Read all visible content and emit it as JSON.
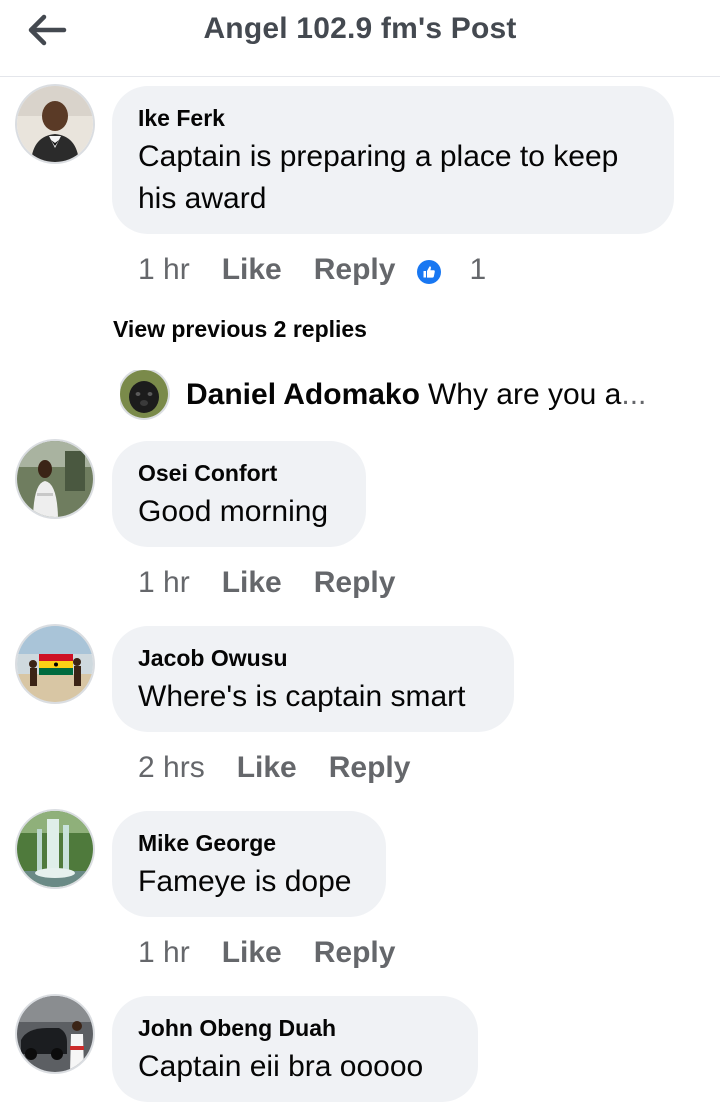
{
  "header": {
    "title": "Angel 102.9 fm's Post"
  },
  "comments": [
    {
      "author": "Ike Ferk",
      "text": "Captain is preparing a place to keep his award",
      "time": "1 hr",
      "like": "Like",
      "reply": "Reply",
      "reaction_count": "1"
    },
    {
      "author": "Osei Confort",
      "text": "Good morning",
      "time": "1 hr",
      "like": "Like",
      "reply": "Reply"
    },
    {
      "author": "Jacob Owusu",
      "text": "Where's is captain smart",
      "time": "2 hrs",
      "like": "Like",
      "reply": "Reply"
    },
    {
      "author": "Mike George",
      "text": "Fameye is dope",
      "time": "1 hr",
      "like": "Like",
      "reply": "Reply"
    },
    {
      "author": "John Obeng Duah",
      "text": "Captain eii bra ooooo"
    }
  ],
  "thread": {
    "view_previous": "View previous 2 replies",
    "preview_author": "Daniel Adomako",
    "preview_text": "Why are you a",
    "preview_ellipsis": "..."
  },
  "icons": {
    "back": "back-arrow-icon",
    "reaction": "like-reaction-icon"
  },
  "colors": {
    "like_blue": "#1877f2",
    "bubble_bg": "#f0f2f5",
    "secondary_text": "#65676b",
    "header_text": "#444950"
  }
}
